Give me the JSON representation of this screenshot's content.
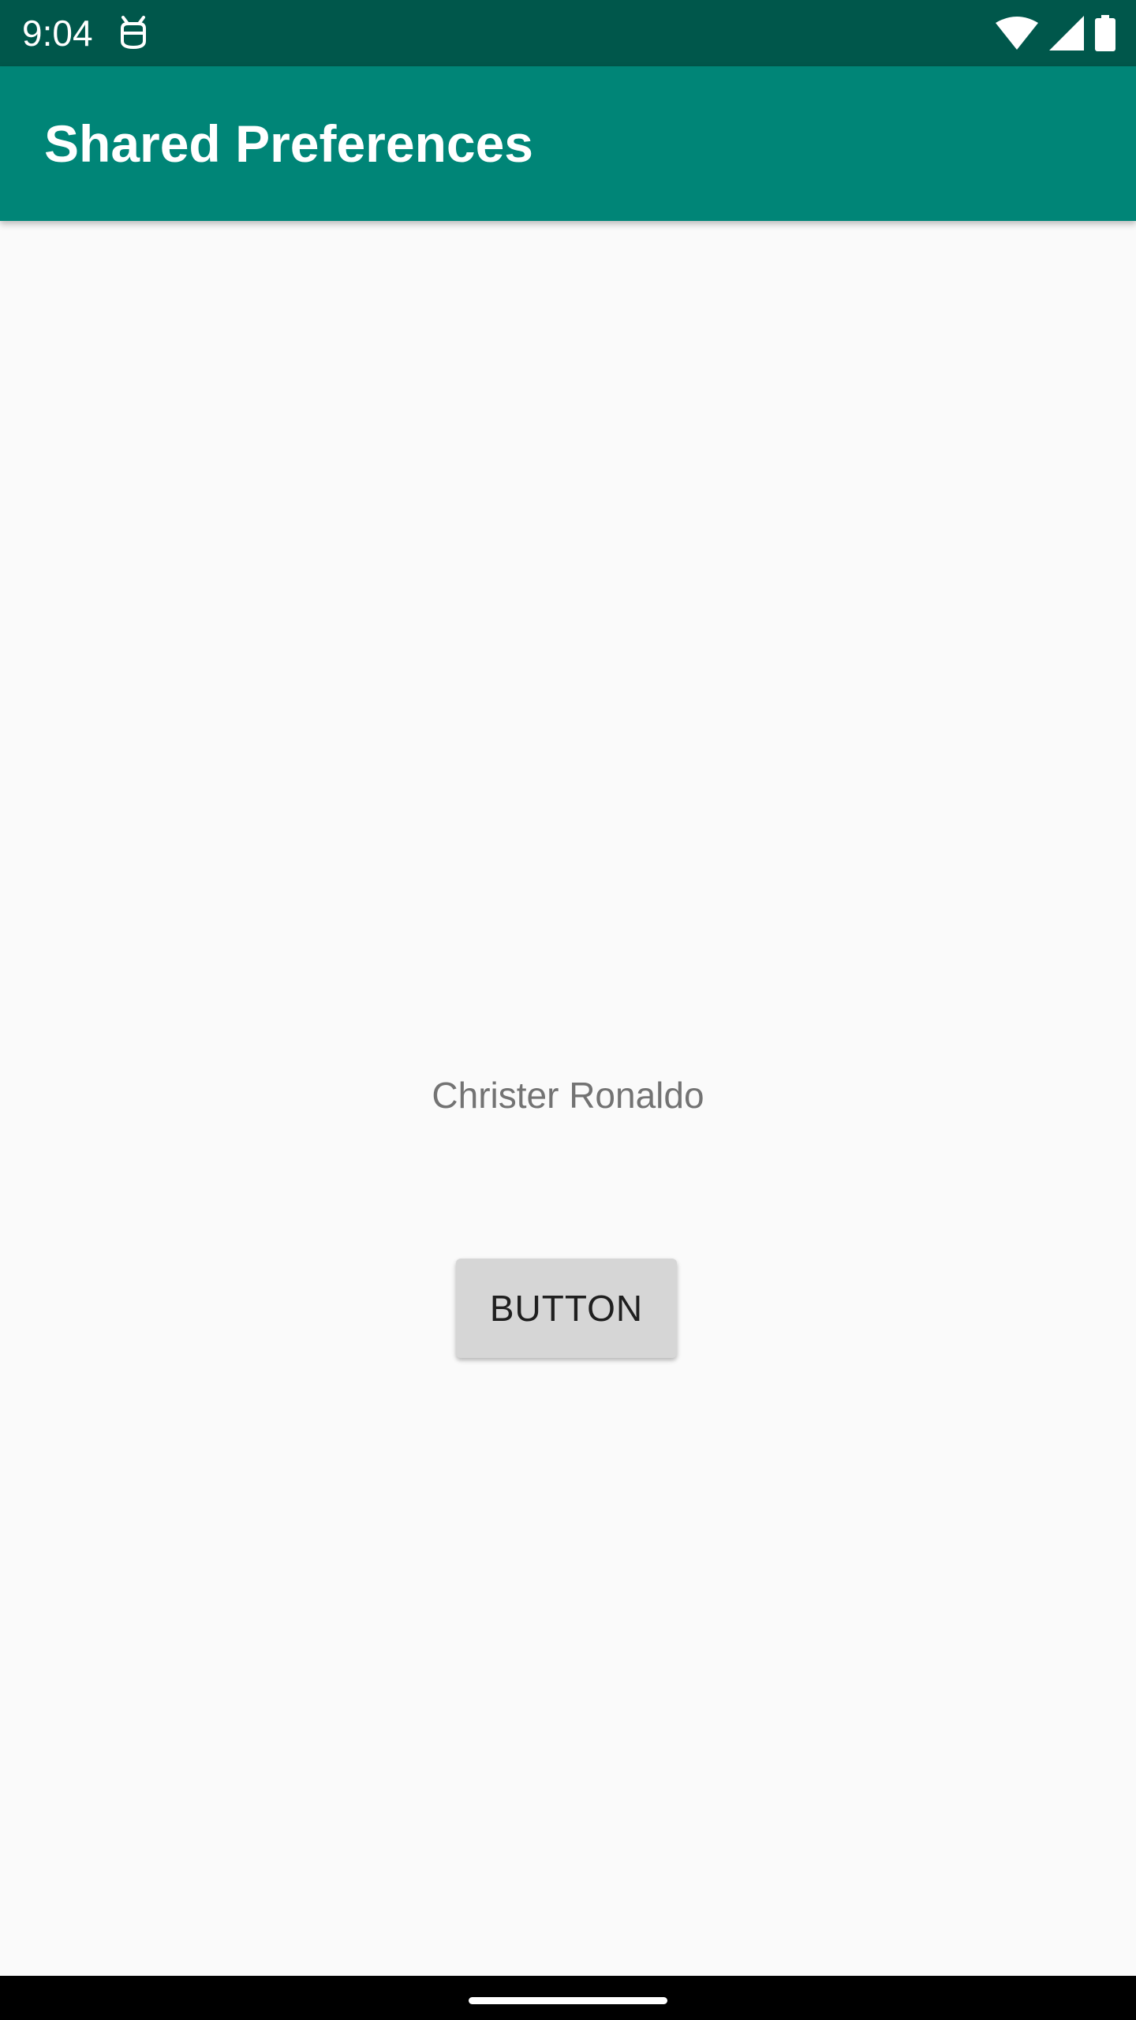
{
  "status_bar": {
    "time": "9:04",
    "icons": [
      "notification-app-icon",
      "wifi-icon",
      "signal-icon",
      "battery-icon"
    ]
  },
  "app_bar": {
    "title": "Shared Preferences"
  },
  "main": {
    "name_text": "Christer Ronaldo",
    "button_label": "BUTTON"
  },
  "colors": {
    "status_bar": "#00574b",
    "app_bar": "#008577",
    "background": "#fafafa",
    "button": "#d6d6d6",
    "text_secondary": "#737373"
  }
}
